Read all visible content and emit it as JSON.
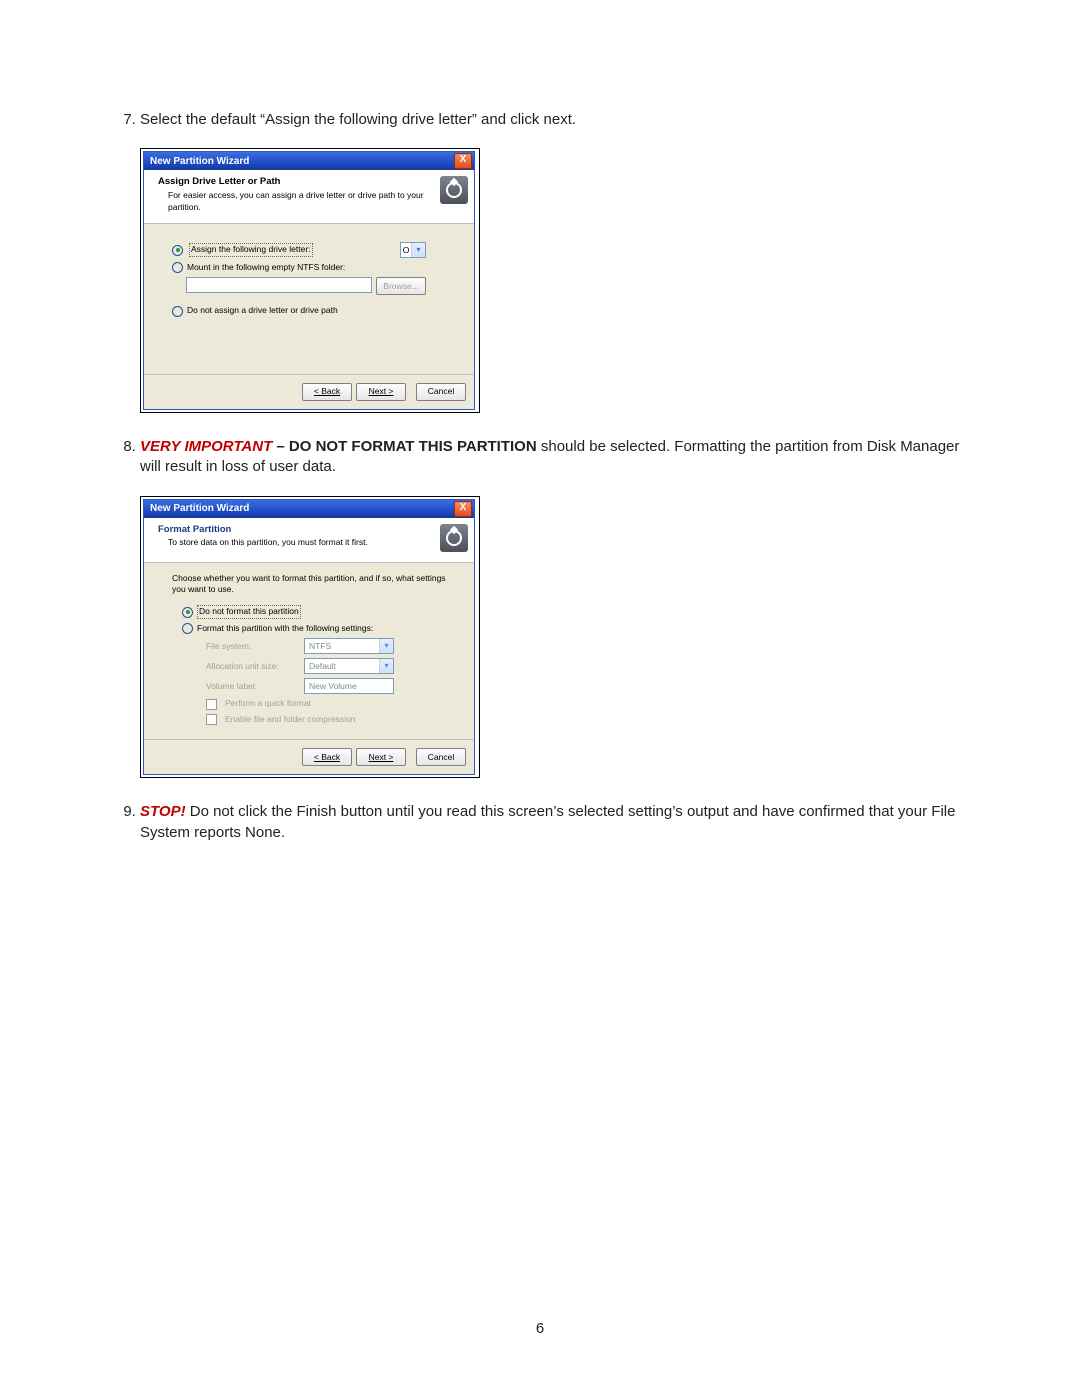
{
  "page_number": "6",
  "items": {
    "7": {
      "num": "7.",
      "text": "Select the default “Assign the following drive letter” and click next."
    },
    "8": {
      "num": "8.",
      "red": "VERY IMPORTANT",
      "bold": " – DO NOT FORMAT THIS PARTITION",
      "tail": " should be selected. Formatting the partition from Disk Manager will result in loss of user data."
    },
    "9": {
      "num": "9.",
      "red": "STOP!",
      "tail": " Do not click the Finish button until you read this screen’s selected setting’s output and have confirmed that your File System reports None."
    }
  },
  "dlg1": {
    "title": "New Partition Wizard",
    "banner_h": "Assign Drive Letter or Path",
    "banner_s": "For easier access, you can assign a drive letter or drive path to your partition.",
    "opt_assign": "Assign the following drive letter:",
    "drive_letter": "O",
    "opt_mount": "Mount in the following empty NTFS folder:",
    "browse": "Browse...",
    "opt_none": "Do not assign a drive letter or drive path",
    "back": "< Back",
    "next": "Next >",
    "cancel": "Cancel"
  },
  "dlg2": {
    "title": "New Partition Wizard",
    "banner_h": "Format Partition",
    "banner_s": "To store data on this partition, you must format it first.",
    "prompt": "Choose whether you want to format this partition, and if so, what settings you want to use.",
    "opt_no": "Do not format this partition",
    "opt_yes": "Format this partition with the following settings:",
    "lbl_fs": "File system:",
    "val_fs": "NTFS",
    "lbl_au": "Allocation unit size:",
    "val_au": "Default",
    "lbl_vl": "Volume label:",
    "val_vl": "New Volume",
    "chk_quick": "Perform a quick format",
    "chk_comp": "Enable file and folder compression",
    "back": "< Back",
    "next": "Next >",
    "cancel": "Cancel"
  }
}
